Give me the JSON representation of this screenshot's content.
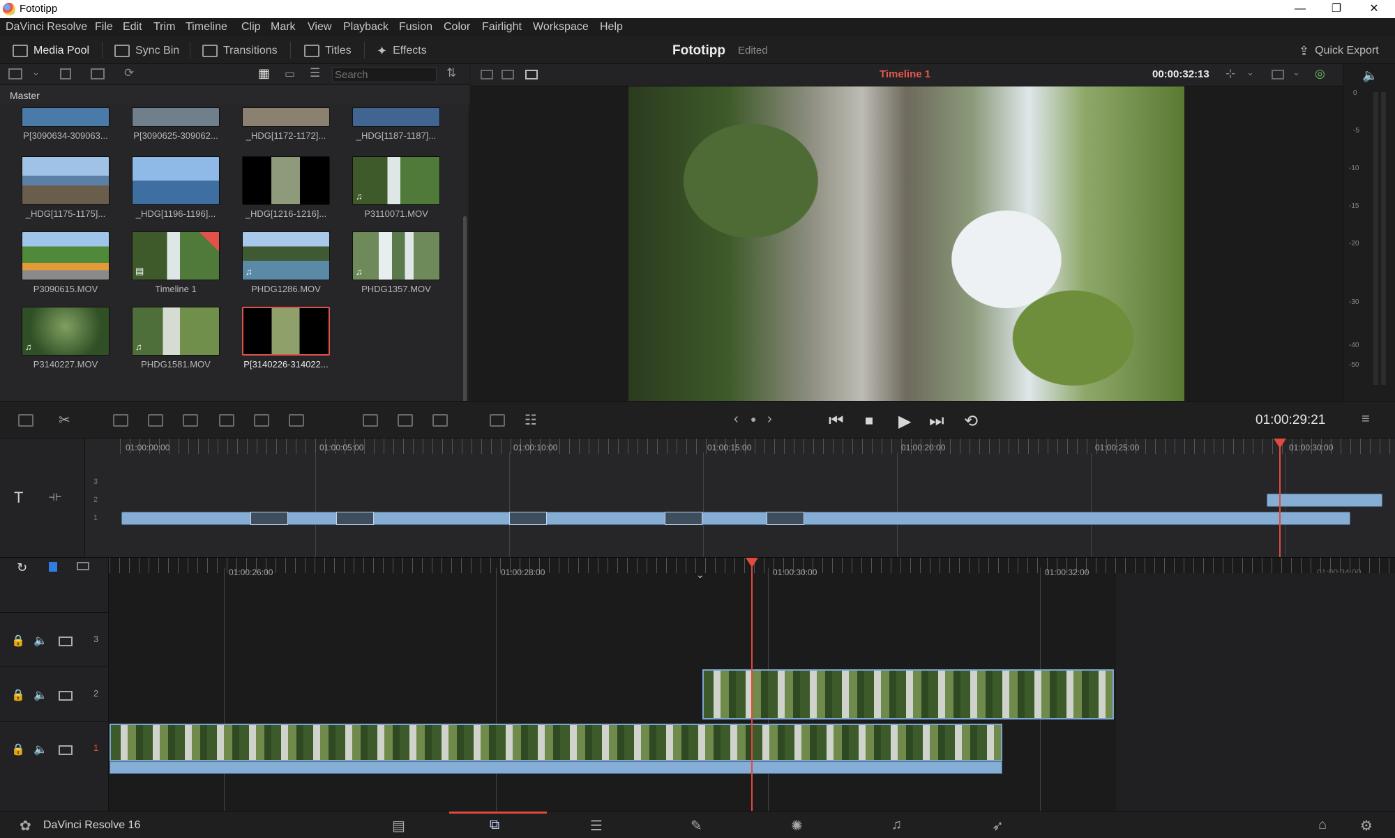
{
  "window": {
    "title": "Fototipp",
    "minimize": "—",
    "restore": "❐",
    "close": "✕"
  },
  "menu": [
    "DaVinci Resolve",
    "File",
    "Edit",
    "Trim",
    "Timeline",
    "Clip",
    "Mark",
    "View",
    "Playback",
    "Fusion",
    "Color",
    "Fairlight",
    "Workspace",
    "Help"
  ],
  "toolbar": {
    "media_pool": "Media Pool",
    "sync_bin": "Sync Bin",
    "transitions": "Transitions",
    "titles": "Titles",
    "effects": "Effects",
    "project_name": "Fototipp",
    "project_status": "Edited",
    "quick_export": "Quick Export"
  },
  "pool": {
    "bin": "Master",
    "search_placeholder": "Search",
    "clips": [
      {
        "label": "P[3090634-309063...",
        "color": "#4a7aa8"
      },
      {
        "label": "P[3090625-309062...",
        "color": "#6f7f8c"
      },
      {
        "label": "_HDG[1172-1172]...",
        "color": "#8c8170"
      },
      {
        "label": "_HDG[1187-1187]...",
        "color": "#3f6590"
      },
      {
        "label": "_HDG[1175-1175]...",
        "color": "#7f9bb8"
      },
      {
        "label": "_HDG[1196-1196]...",
        "color": "#6f9ecc"
      },
      {
        "label": "_HDG[1216-1216]...",
        "color": "#5a6a50"
      },
      {
        "label": "P3110071.MOV",
        "color": "#4f7a3a"
      },
      {
        "label": "P3090615.MOV",
        "color": "#5f9a4a"
      },
      {
        "label": "Timeline 1",
        "color": "#4f7a3a"
      },
      {
        "label": "PHDG1286.MOV",
        "color": "#5b8aa6"
      },
      {
        "label": "PHDG1357.MOV",
        "color": "#6e8a5a"
      },
      {
        "label": "P3140227.MOV",
        "color": "#2f4f25"
      },
      {
        "label": "PHDG1581.MOV",
        "color": "#6f8f4a"
      },
      {
        "label": "P[3140226-314022...",
        "color": "#3f5a32"
      }
    ]
  },
  "viewer": {
    "timeline_name": "Timeline 1",
    "duration": "00:00:32:13",
    "timecode": "01:00:29:21"
  },
  "meter_ticks": [
    "0",
    "-5",
    "-10",
    "-15",
    "-20",
    "-30",
    "-40",
    "-50"
  ],
  "upper_ruler": [
    "01:00:00:00",
    "01:00:05:00",
    "01:00:10:00",
    "01:00:15:00",
    "01:00:20:00",
    "01:00:25:00",
    "01:00:30:00"
  ],
  "lower_ruler": [
    "01:00:26:00",
    "01:00:28:00",
    "01:00:30:00",
    "01:00:32:00",
    "01:00:34:00"
  ],
  "tracks": [
    "3",
    "2",
    "1"
  ],
  "app_name": "DaVinci Resolve 16",
  "colors": {
    "accent": "#e04a3f",
    "clip": "#86add4"
  }
}
